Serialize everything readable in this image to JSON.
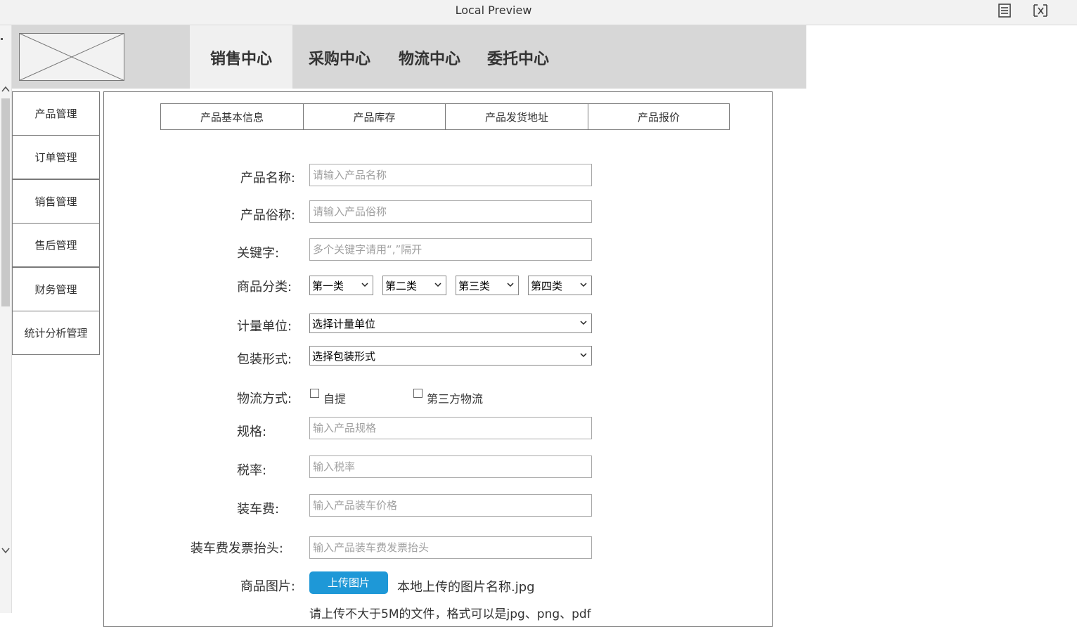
{
  "window": {
    "title": "Local Preview"
  },
  "nav": {
    "tabs": [
      {
        "label": "销售中心",
        "active": true
      },
      {
        "label": "采购中心",
        "active": false
      },
      {
        "label": "物流中心",
        "active": false
      },
      {
        "label": "委托中心",
        "active": false
      }
    ]
  },
  "sidebar": {
    "items": [
      {
        "label": "产品管理"
      },
      {
        "label": "订单管理"
      },
      {
        "label": "销售管理"
      },
      {
        "label": "售后管理"
      },
      {
        "label": "财务管理"
      },
      {
        "label": "统计分析管理"
      }
    ]
  },
  "subtabs": [
    {
      "label": "产品基本信息"
    },
    {
      "label": "产品库存"
    },
    {
      "label": "产品发货地址"
    },
    {
      "label": "产品报价"
    }
  ],
  "form": {
    "product_name": {
      "label": "产品名称:",
      "placeholder": "请输入产品名称"
    },
    "product_alias": {
      "label": "产品俗称:",
      "placeholder": "请输入产品俗称"
    },
    "keywords": {
      "label": "关键字:",
      "placeholder": "多个关键字请用“,”隔开"
    },
    "category": {
      "label": "商品分类:",
      "selects": [
        {
          "value": "第一类"
        },
        {
          "value": "第二类"
        },
        {
          "value": "第三类"
        },
        {
          "value": "第四类"
        }
      ]
    },
    "unit": {
      "label": "计量单位:",
      "value": "选择计量单位"
    },
    "packaging": {
      "label": "包装形式:",
      "value": "选择包装形式"
    },
    "logistics": {
      "label": "物流方式:",
      "options": [
        {
          "label": "自提",
          "checked": false
        },
        {
          "label": "第三方物流",
          "checked": false
        }
      ]
    },
    "spec": {
      "label": "规格:",
      "placeholder": "输入产品规格"
    },
    "tax": {
      "label": "税率:",
      "placeholder": "输入税率"
    },
    "loading_fee": {
      "label": "装车费:",
      "placeholder": "输入产品装车价格"
    },
    "invoice_title": {
      "label": "装车费发票抬头:",
      "placeholder": "输入产品装车费发票抬头"
    },
    "image": {
      "label": "商品图片:",
      "button": "上传图片",
      "file_name": "本地上传的图片名称.jpg",
      "hint": "请上传不大于5M的文件，格式可以是jpg、png、pdf"
    }
  },
  "colors": {
    "upload_button": "#1e98d7",
    "header_bg": "#d7d7d7",
    "active_tab_bg": "#f0f0f0"
  }
}
